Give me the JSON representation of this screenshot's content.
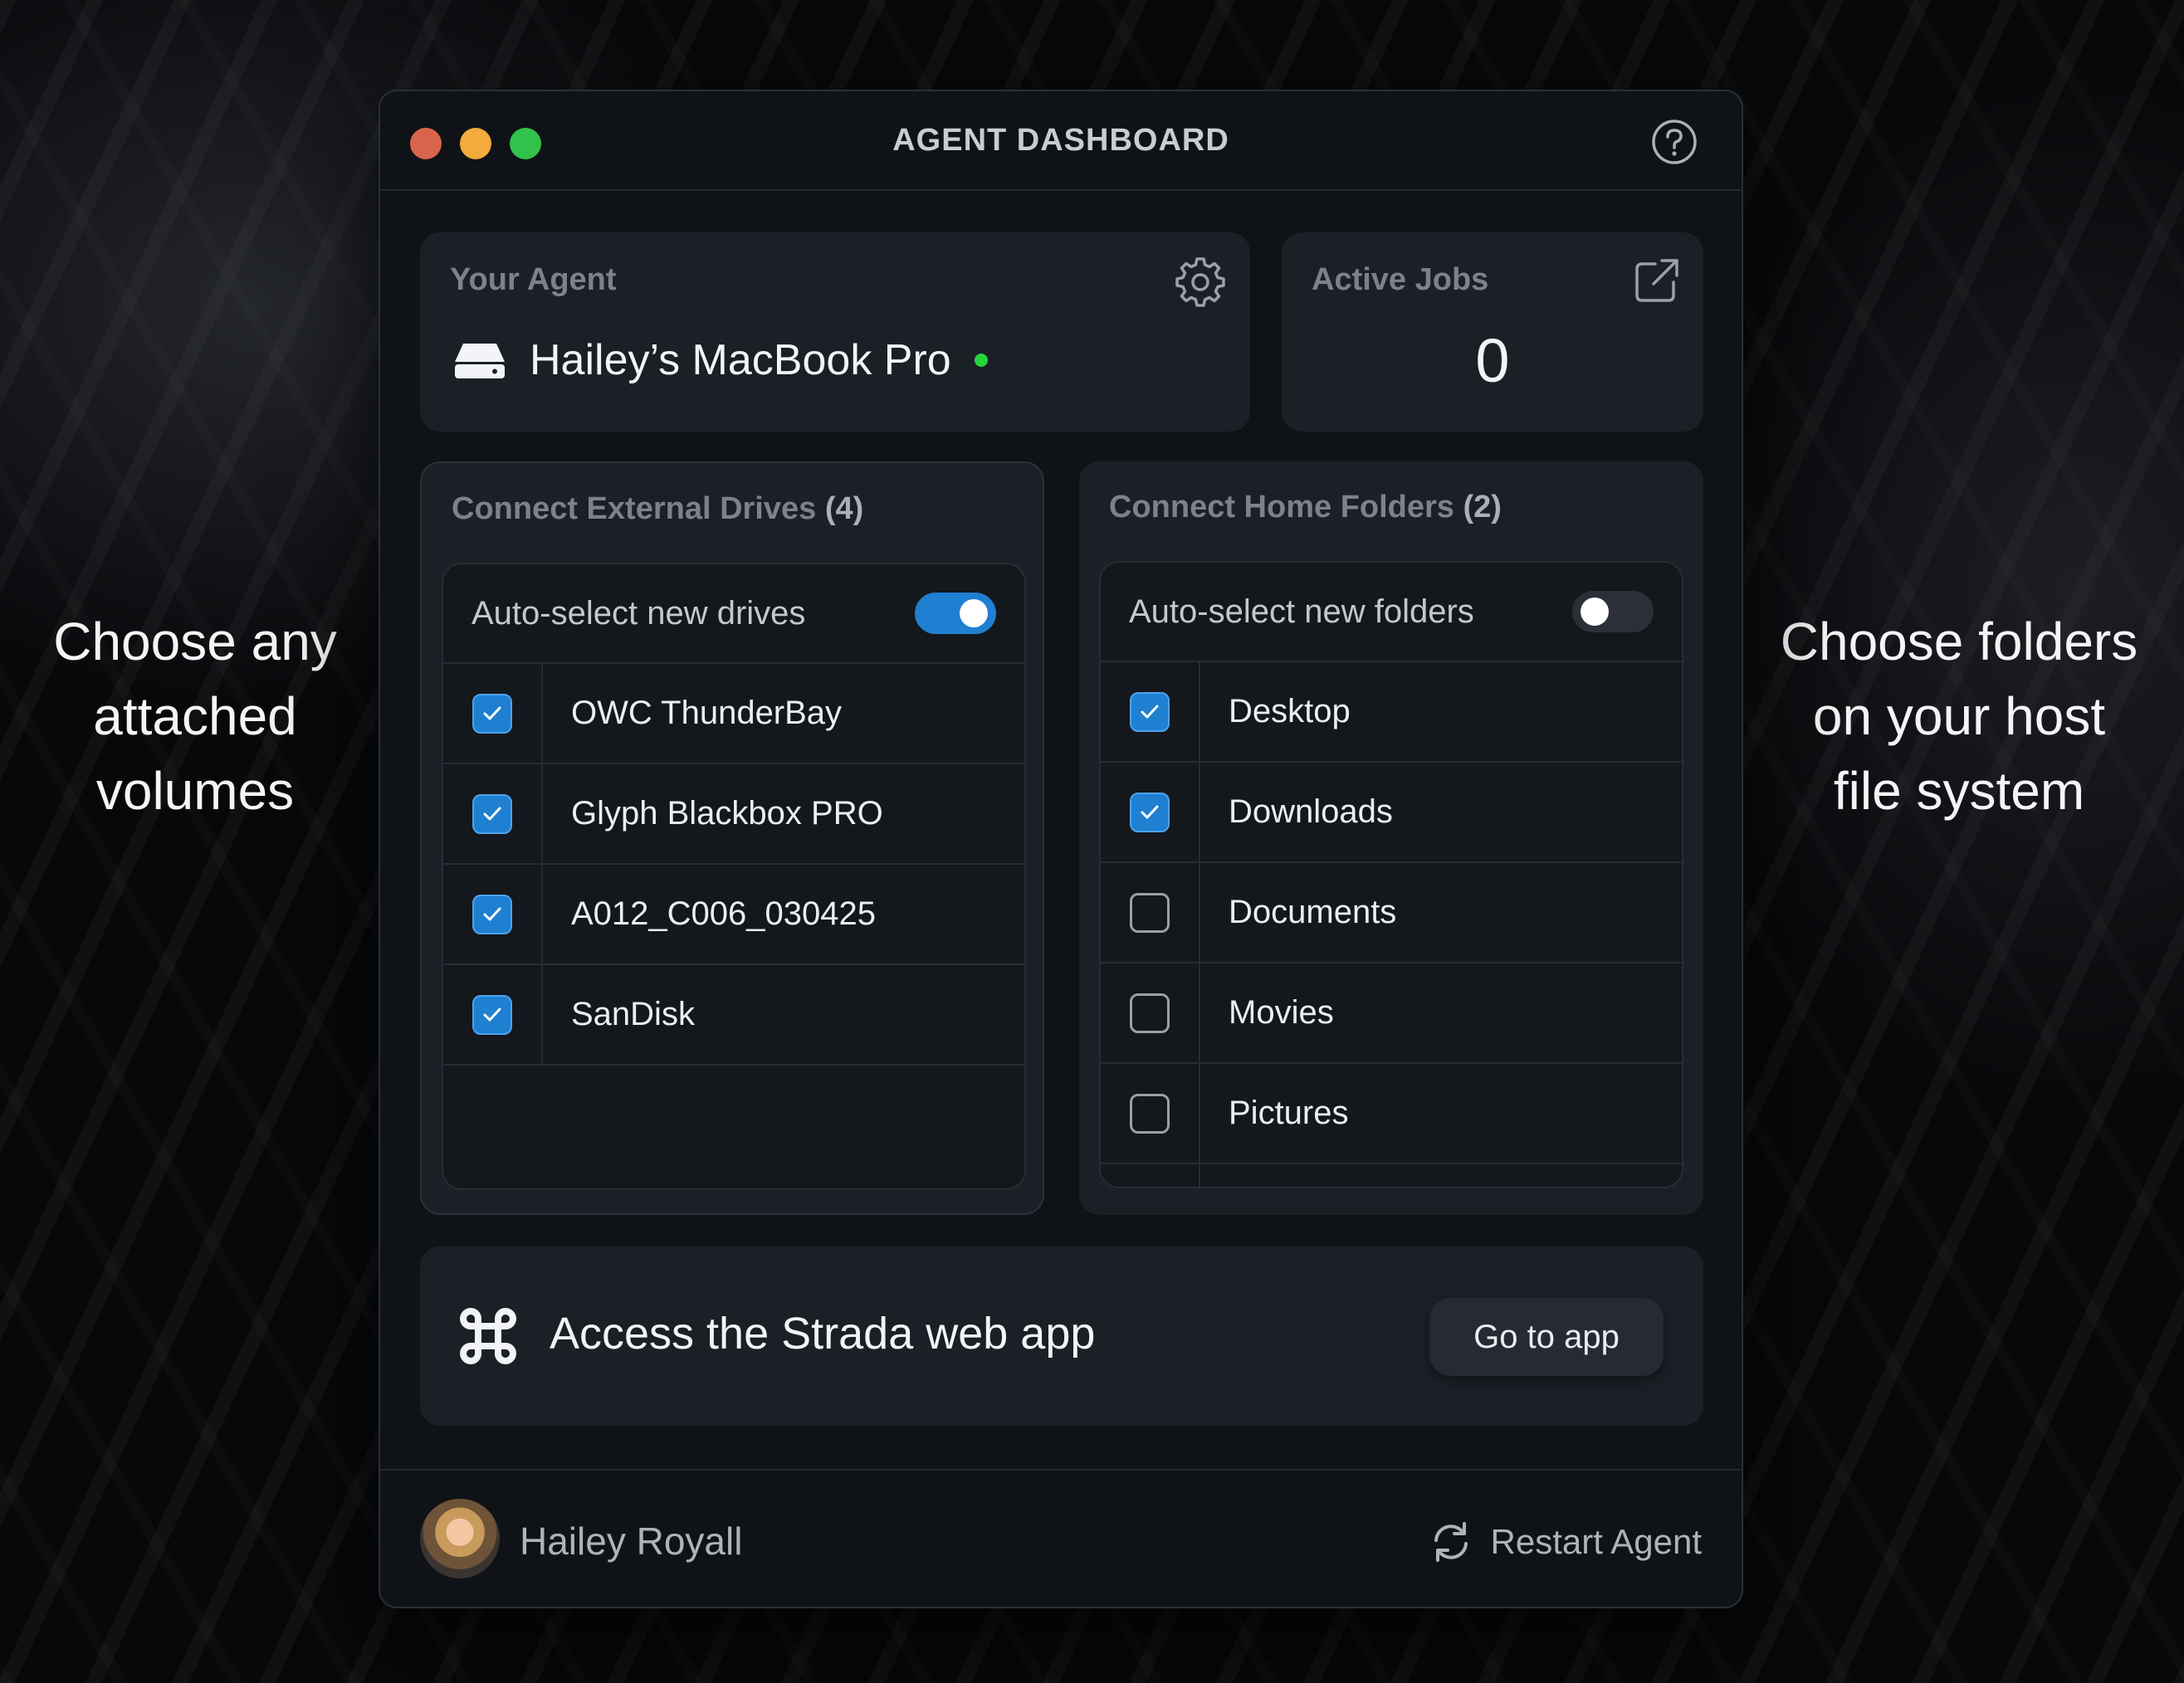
{
  "annotations": {
    "left": [
      "Choose any",
      "attached",
      "volumes"
    ],
    "right": [
      "Choose folders",
      "on your host",
      "file system"
    ]
  },
  "window": {
    "title": "AGENT DASHBOARD"
  },
  "agent_card": {
    "label": "Your Agent",
    "name": "Hailey’s MacBook Pro",
    "status": "online"
  },
  "jobs_card": {
    "label": "Active Jobs",
    "value": "0"
  },
  "drives_panel": {
    "label": "Connect External Drives",
    "count": "(4)",
    "auto_label": "Auto-select new drives",
    "auto_enabled": true,
    "items": [
      {
        "label": "OWC ThunderBay",
        "checked": true
      },
      {
        "label": "Glyph Blackbox PRO",
        "checked": true
      },
      {
        "label": "A012_C006_030425",
        "checked": true
      },
      {
        "label": "SanDisk",
        "checked": true
      }
    ]
  },
  "folders_panel": {
    "label": "Connect Home Folders",
    "count": "(2)",
    "auto_label": "Auto-select new folders",
    "auto_enabled": false,
    "items": [
      {
        "label": "Desktop",
        "checked": true
      },
      {
        "label": "Downloads",
        "checked": true
      },
      {
        "label": "Documents",
        "checked": false
      },
      {
        "label": "Movies",
        "checked": false
      },
      {
        "label": "Pictures",
        "checked": false
      }
    ]
  },
  "web_app_card": {
    "text": "Access the Strada web app",
    "button_label": "Go to app"
  },
  "footer": {
    "user_name": "Hailey Royall",
    "restart_label": "Restart Agent"
  },
  "colors": {
    "accent": "#1f7fd1",
    "online": "#22d63a",
    "traffic_red": "#d9644c",
    "traffic_yellow": "#f2ab3c",
    "traffic_green": "#32c24b"
  }
}
